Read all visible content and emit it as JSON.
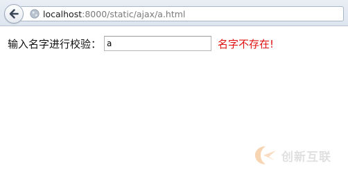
{
  "browser": {
    "url_host": "localhost",
    "url_path": ":8000/static/ajax/a.html"
  },
  "form": {
    "label": "输入名字进行校验：",
    "input_value": "a",
    "validation_message": "名字不存在!"
  },
  "watermark": {
    "text": "创新互联"
  },
  "colors": {
    "error": "#e01010",
    "chrome": "#dde5ef"
  },
  "icons": {
    "back": "back-arrow-icon",
    "site": "globe-icon",
    "watermark": "watermark-logo-icon"
  }
}
